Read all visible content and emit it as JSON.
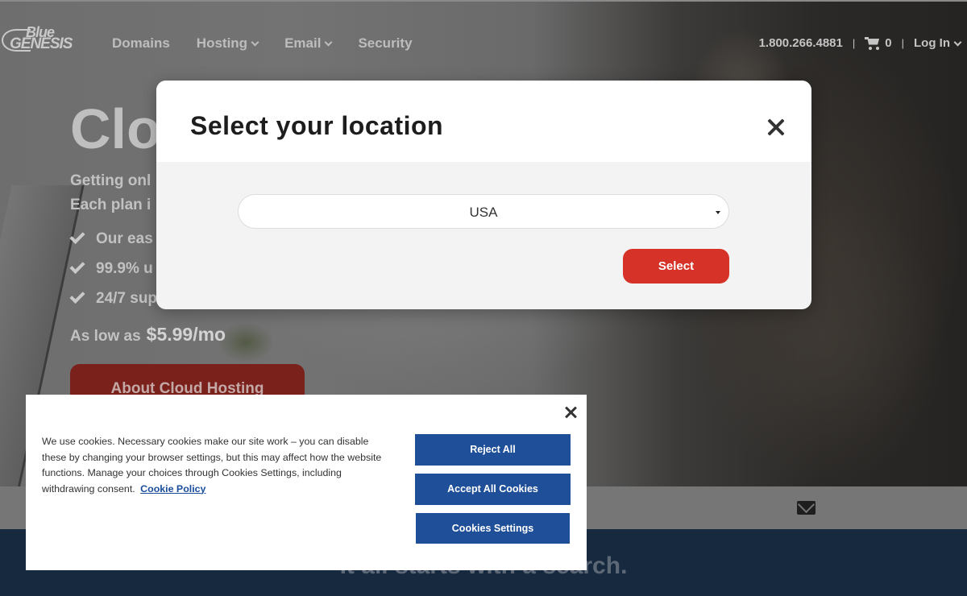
{
  "nav": {
    "logo_line1": "Blue",
    "logo_line2": "GENESIS",
    "links": [
      {
        "label": "Domains",
        "has_dropdown": false
      },
      {
        "label": "Hosting",
        "has_dropdown": true
      },
      {
        "label": "Email",
        "has_dropdown": true
      },
      {
        "label": "Security",
        "has_dropdown": false
      }
    ],
    "phone": "1.800.266.4881",
    "separator": "|",
    "cart_count": "0",
    "login_label": "Log In"
  },
  "hero": {
    "title": "Clo",
    "subtitle_line1": "Getting onl",
    "subtitle_line2": "Each plan i",
    "features": [
      "Our eas",
      "99.9% u",
      "24/7 sup"
    ],
    "price_prefix": "As low as",
    "price_value": "$5.99/mo",
    "cta_label": "About Cloud Hosting"
  },
  "search_band": {
    "text": "It all starts with a search."
  },
  "location_modal": {
    "title": "Select your location",
    "selected_location": "USA",
    "select_button": "Select"
  },
  "cookie_banner": {
    "text": "We use cookies. Necessary cookies make our site work – you can disable these by changing your browser settings, but this may affect how the website functions. Manage your choices through Cookies Settings, including withdrawing consent.",
    "policy_link": "Cookie Policy",
    "reject_label": "Reject All",
    "accept_label": "Accept All Cookies",
    "settings_label": "Cookies Settings"
  },
  "colors": {
    "primary_red": "#d63228",
    "cookie_blue": "#1f4f98",
    "search_band_navy": "#17293f"
  }
}
